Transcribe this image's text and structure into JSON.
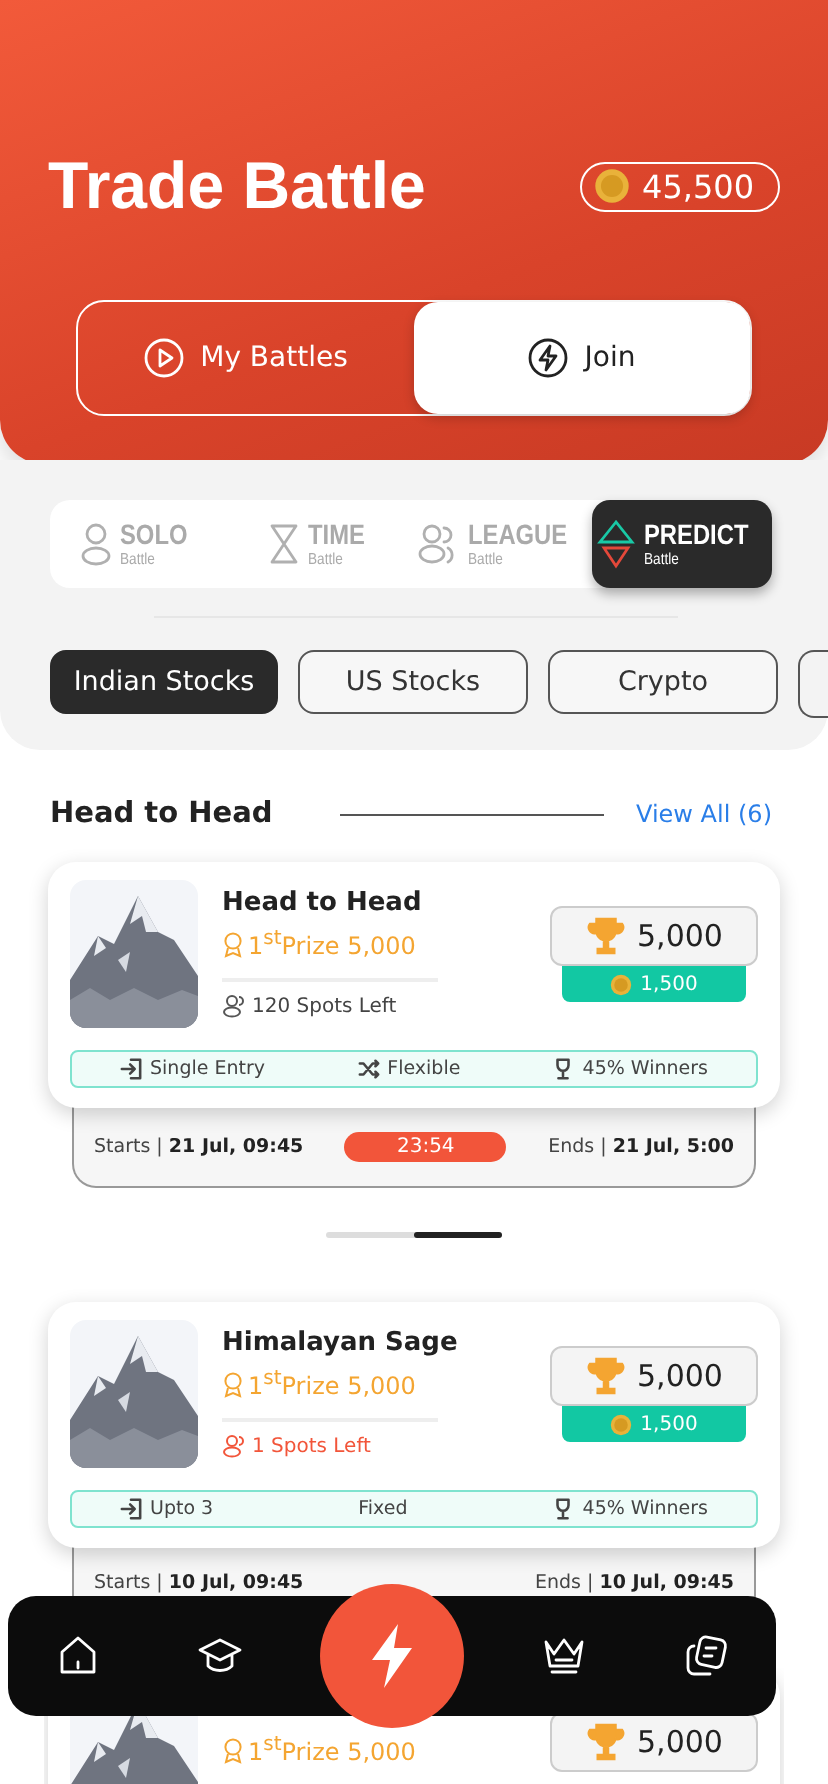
{
  "header": {
    "title": "Trade Battle",
    "coins": "45,500"
  },
  "modes": [
    {
      "label": "My Battles",
      "selected": false
    },
    {
      "label": "Join",
      "selected": true
    }
  ],
  "battle_types": [
    {
      "label": "SOLO",
      "sub": "Battle",
      "selected": false
    },
    {
      "label": "TIME",
      "sub": "Battle",
      "selected": false
    },
    {
      "label": "LEAGUE",
      "sub": "Battle",
      "selected": false
    },
    {
      "label": "PREDICT",
      "sub": "Battle",
      "selected": true
    }
  ],
  "categories": [
    {
      "label": "Indian Stocks",
      "selected": true
    },
    {
      "label": "US Stocks",
      "selected": false
    },
    {
      "label": "Crypto",
      "selected": false
    }
  ],
  "section": {
    "title": "Head to Head",
    "link": "View All (6)"
  },
  "cards": [
    {
      "title": "Head to Head",
      "prize": "1$^{st}$Prize 5,000",
      "spots": "120 Spots Left",
      "urgent": false,
      "pool": "5,000",
      "entry": "1,500",
      "features": [
        {
          "text": "Single Entry",
          "kind": "entry"
        },
        {
          "text": "Flexible",
          "kind": "shuffle"
        },
        {
          "text": "45% Winners",
          "kind": "winners"
        }
      ],
      "starts_label": "Starts |",
      "starts": "21 Jul, 09:45",
      "timer": "23:54",
      "ends_label": "Ends |",
      "ends": "21 Jul, 5:00"
    },
    {
      "title": "Himalayan Sage",
      "prize": "1$^{st}$Prize 5,000",
      "spots": "1 Spots Left",
      "urgent": true,
      "pool": "5,000",
      "entry": "1,500",
      "features": [
        {
          "text": "Upto 3",
          "kind": "entry"
        },
        {
          "text": "Fixed",
          "kind": "plain"
        },
        {
          "text": "45% Winners",
          "kind": "winners"
        }
      ],
      "starts_label": "Starts |",
      "starts": "10 Jul, 09:45",
      "ends_label": "Ends |",
      "ends": "10 Jul, 09:45"
    },
    {
      "prize": "1$^{st}$Prize 5,000",
      "pool": "5,000"
    }
  ],
  "nav": [
    {
      "selected": false
    },
    {
      "selected": false
    },
    {
      "selected": true
    },
    {
      "selected": false
    },
    {
      "selected": false
    }
  ]
}
